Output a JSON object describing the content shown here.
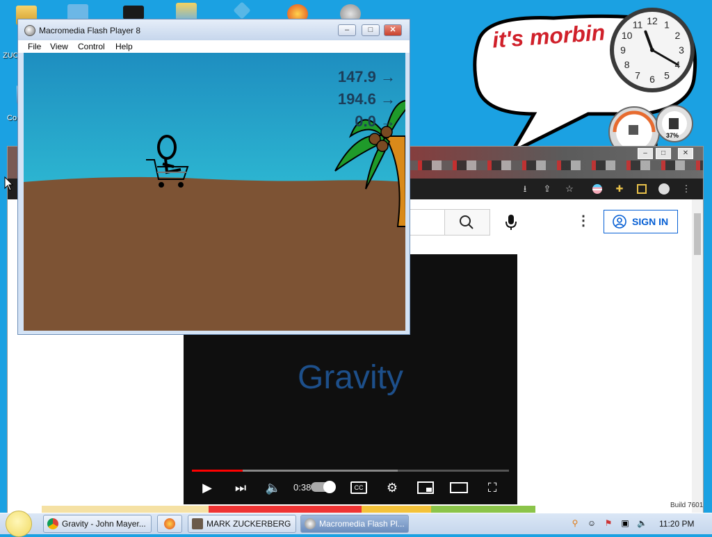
{
  "desktop": {
    "icon_labels": [
      "ZUC",
      "Co"
    ],
    "bubble_text": "it's morbin",
    "gauge_percent": "37%",
    "build_text": "Build 7601"
  },
  "clock_widget": {
    "numerals": [
      "12",
      "1",
      "2",
      "3",
      "4",
      "5",
      "6",
      "7",
      "8",
      "9",
      "10",
      "11"
    ],
    "hour": 11,
    "minute": 20
  },
  "flash": {
    "title": "Macromedia Flash Player 8",
    "menu": [
      "File",
      "View",
      "Control",
      "Help"
    ],
    "stats": [
      "147.9 →",
      "194.6 →",
      "0.0 →"
    ],
    "colors": {
      "sky": "#2aa6c9",
      "ground": "#7d5334"
    }
  },
  "browser": {
    "sign_in_label": "SIGN IN",
    "video_title": "Gravity",
    "time_text": "0:38",
    "progress_fraction": 0.16,
    "buffer_fraction": 0.65
  },
  "taskbar": {
    "buttons": [
      "Gravity - John Mayer...",
      "MARK ZUCKERBERG",
      "Macromedia Flash Pl..."
    ],
    "time": "11:20 PM"
  }
}
